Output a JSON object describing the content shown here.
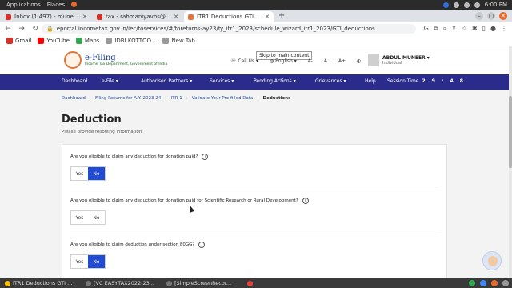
{
  "os_bar": {
    "applications": "Applications",
    "places": "Places",
    "time": "6:00 PM"
  },
  "browser": {
    "tabs": [
      {
        "label": "Inbox (1,497) - muneer.v",
        "active": false
      },
      {
        "label": "tax - rahmaniyavhs@gma",
        "active": false
      },
      {
        "label": "ITR1 Deductions GTI ded",
        "active": true
      }
    ],
    "new_tab": "+",
    "url": "eportal.incometax.gov.in/iec/foservices/#/foreturns-ay23/fy_itr1_2023/schedule_wizard_itr1_2023/GTI_deductions",
    "bookmarks": [
      "Gmail",
      "YouTube",
      "Maps",
      "IDBI KOTTOO...",
      "New Tab"
    ]
  },
  "site": {
    "logo_title": "e-Filing",
    "logo_tagline": "Income Tax Department, Government of India",
    "skip_link": "Skip to main content",
    "call_us": "Call Us",
    "language": "English",
    "font_controls": [
      "A-",
      "A",
      "A+"
    ],
    "user_name": "ABDUL MUNEER",
    "user_type": "Individual",
    "nav_items": [
      "Dashboard",
      "e-File",
      "Authorised Partners",
      "Services",
      "Pending Actions",
      "Grievances",
      "Help"
    ],
    "session_label": "Session Time",
    "session_time": "2 9 : 4 8"
  },
  "breadcrumb": [
    "Dashboard",
    "Filing Returns for A.Y. 2023-24",
    "ITR-1",
    "Validate Your Pre-filled Data",
    "Deductions"
  ],
  "page": {
    "title": "Deduction",
    "subtitle": "Please provide following information"
  },
  "questions": [
    {
      "text": "Are you eligible to claim any deduction for donation paid?",
      "yes": "Yes",
      "no": "No",
      "selected": "No"
    },
    {
      "text": "Are you eligible to claim any deduction for donation paid for Scientific Research or Rural Development?",
      "yes": "Yes",
      "no": "No",
      "selected": ""
    },
    {
      "text": "Are you eligible to claim deduction under section 80GG?",
      "yes": "Yes",
      "no": "No",
      "selected": "No"
    }
  ],
  "taskbar": [
    "ITR1 Deductions GTI ...",
    "[VC EASYTAX2022-23...",
    "[SimpleScreenRecor..."
  ],
  "colors": {
    "nav_bg": "#2b2b8c",
    "selected_toggle": "#1f4bd6"
  }
}
